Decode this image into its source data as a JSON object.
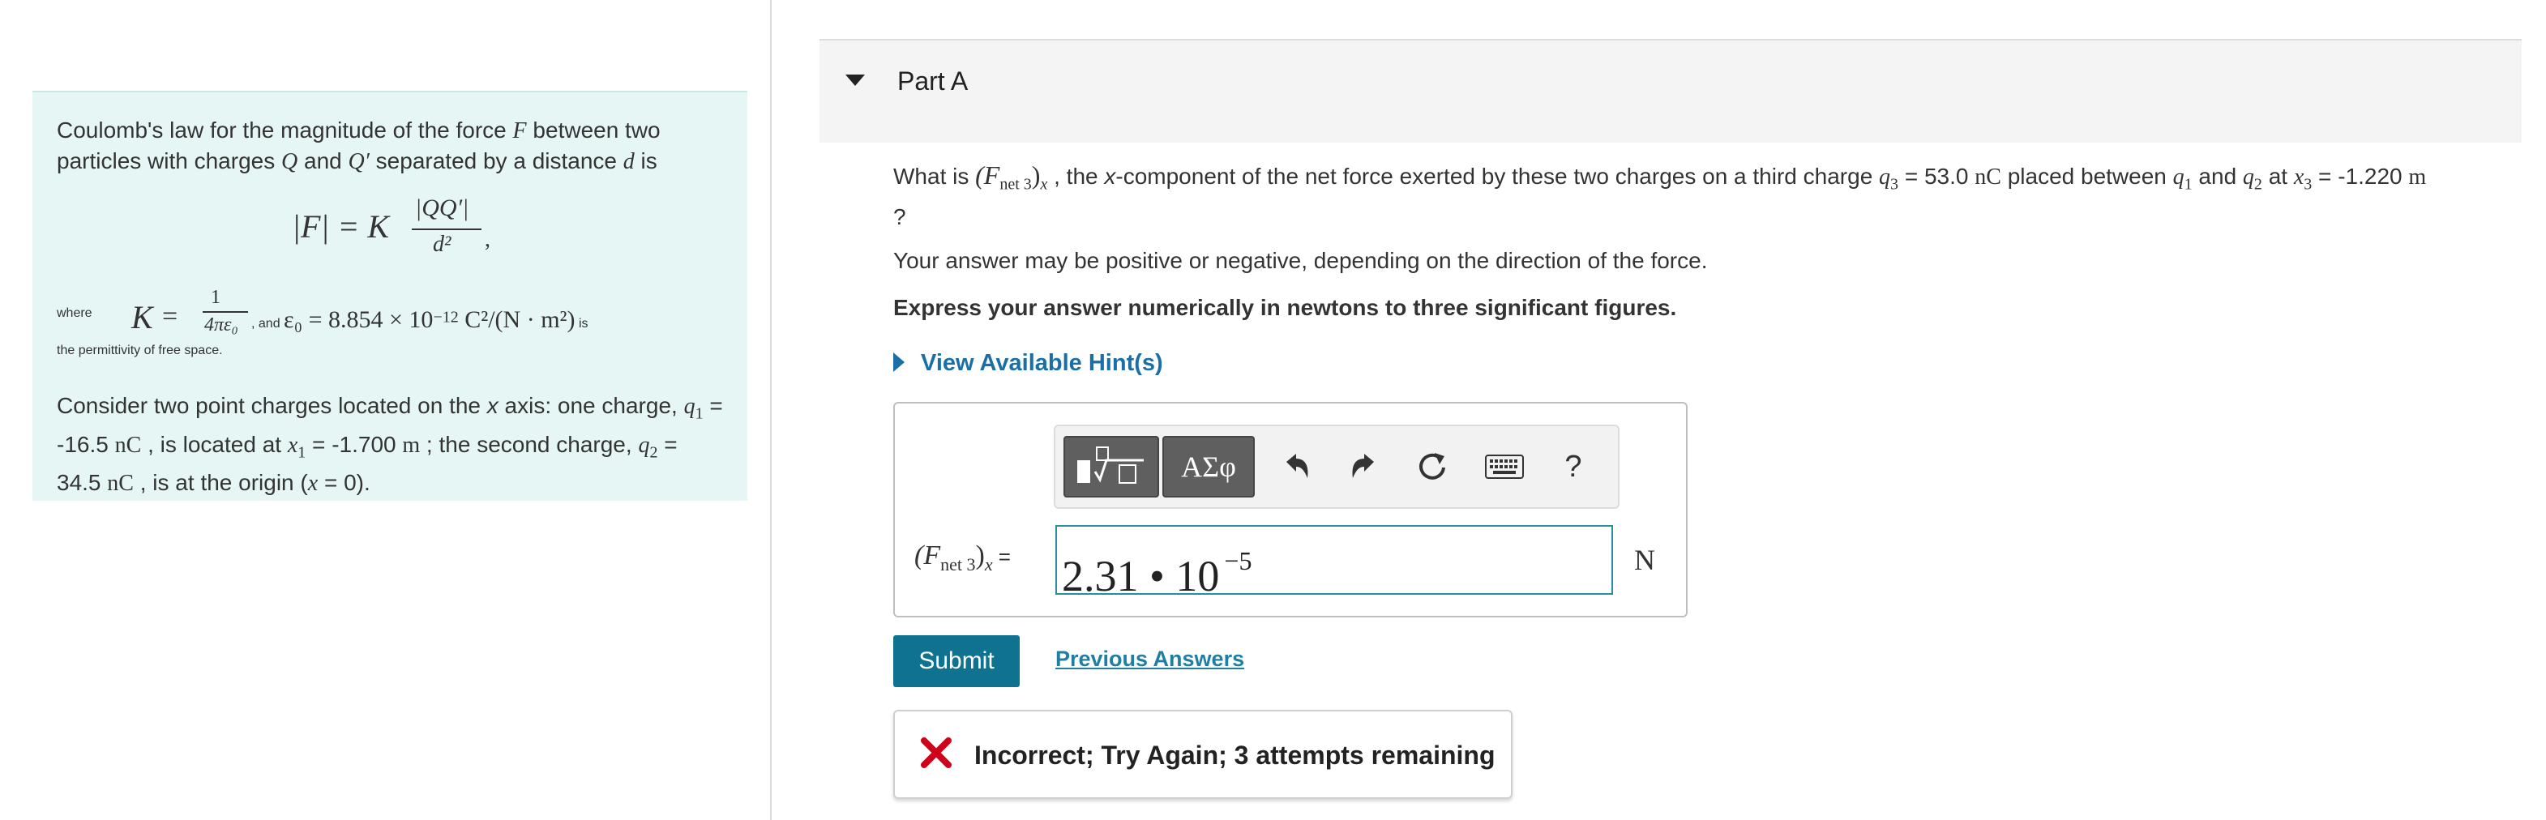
{
  "intro": {
    "p1_a": "Coulomb's law for the magnitude of the force ",
    "p1_F": "F",
    "p1_b": " between two particles with charges ",
    "p1_Q": "Q",
    "p1_c": " and ",
    "p1_Qp": "Q′",
    "p1_d_text": " separated by a distance ",
    "p1_d": "d",
    "p1_e": " is",
    "formula_lhs": "|F| = K",
    "formula_num": "|QQ′|",
    "formula_den": "d²",
    "formula_comma": ",",
    "where": "where",
    "K": "K",
    "eq": "=",
    "kfrac_num": "1",
    "kfrac_den": "4πε₀",
    "and_eps_a": ", and ",
    "eps_expr": "ε₀ = 8.854 × 10",
    "eps_exp": "−12",
    "eps_units": " C²/(N · m²)",
    "is": " is",
    "p2_line2": "the permittivity of free space.",
    "p3_a": "Consider two point charges located on the ",
    "p3_x": "x",
    "p3_b": " axis: one charge, ",
    "p3_q1": "q",
    "p3_q1_sub": "1",
    "p3_c": " = -16.5 ",
    "p3_unit1": "nC",
    "p3_d": " , is located at ",
    "p3_x1": "x",
    "p3_x1_sub": "1",
    "p3_e": " = -1.700 ",
    "p3_unit2": "m",
    "p3_f": " ; the second charge, ",
    "p3_q2": "q",
    "p3_q2_sub": "2",
    "p3_g": " = 34.5 ",
    "p3_unit3": "nC",
    "p3_h": " , is at the origin (",
    "p3_x0": "x",
    "p3_i": " = 0)."
  },
  "part": {
    "title": "Part A"
  },
  "question": {
    "a": "What is ",
    "F": "(F",
    "net3": "net 3",
    "close": ")",
    "x_sub": "x",
    "b": " , the ",
    "x_word": "x",
    "c": "-component of the net force exerted by these two charges on a third charge ",
    "q3": "q",
    "q3_sub": "3",
    "d": " = 53.0 ",
    "unit_nC": "nC",
    "e": " placed between ",
    "q1": "q",
    "q1_sub": "1",
    "f": " and ",
    "q2": "q",
    "q2_sub": "2",
    "g": " at ",
    "x3": "x",
    "x3_sub": "3",
    "h": " = -1.220 ",
    "unit_m": "m",
    "i": " ?"
  },
  "hint_line": "Your answer may be positive or negative, depending on the direction of the force.",
  "express_line": "Express your answer numerically in newtons to three significant figures.",
  "hint_link": "View Available Hint(s)",
  "toolbar": {
    "greek_label": "ΑΣφ",
    "help_label": "?"
  },
  "answer": {
    "label_F": "(F",
    "label_net": "net 3",
    "label_close": ")",
    "label_x": "x",
    "label_eq": " =",
    "value_mantissa": "2.31 • 10",
    "value_exponent": "−5",
    "unit": "N"
  },
  "submit_label": "Submit",
  "previous_answers_label": "Previous Answers",
  "feedback": {
    "text": "Incorrect; Try Again; 3 attempts remaining",
    "icon_color": "#d0021b"
  },
  "colors": {
    "intro_bg": "#e5f6f5",
    "submit_bg": "#0f7291",
    "link": "#1a6fa6",
    "input_border": "#2a8ea1"
  }
}
